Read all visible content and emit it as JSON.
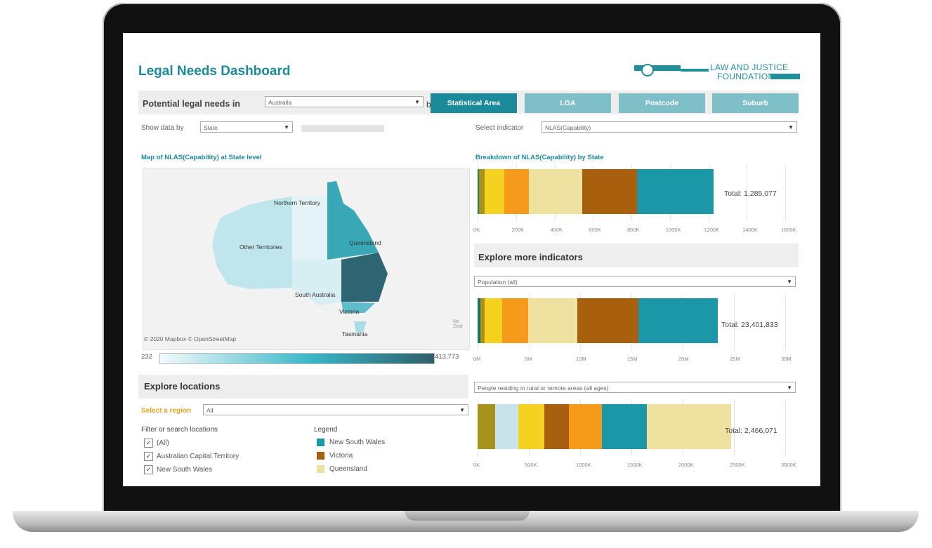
{
  "dashboard": {
    "title": "Legal Needs Dashboard",
    "logo_line1": "LAW AND JUSTICE",
    "logo_line2": "FOUNDATION"
  },
  "toolbar": {
    "label": "Potential legal needs in",
    "country_value": "Australia",
    "by_label": "by",
    "tabs": [
      {
        "label": "Statistical Area",
        "active": true
      },
      {
        "label": "LGA",
        "active": false
      },
      {
        "label": "Postcode",
        "active": false
      },
      {
        "label": "Suburb",
        "active": false
      }
    ]
  },
  "filters": {
    "show_data_by_label": "Show data by",
    "show_data_by_value": "State",
    "select_indicator_label": "Select indicator",
    "select_indicator_value": "NLAS(Capability)"
  },
  "map": {
    "section_label": "Map of NLAS(Capability) at State level",
    "labels": [
      "Northern Territory",
      "Other Territories",
      "Queensland",
      "South Australia",
      "Victoria",
      "Tasmania"
    ],
    "copyright": "© 2020 Mapbox © OpenStreetMap",
    "mapbox_note": "Ne Zeal",
    "scale_min": "232",
    "scale_max": "413,773"
  },
  "breakdown": {
    "section_label": "Breakdown of NLAS(Capability) by State",
    "total": "Total: 1,285,077"
  },
  "explore_indicators": {
    "heading": "Explore more indicators",
    "select1": "Population (all)",
    "total1": "Total: 23,401,833",
    "select2": "People residing in rural or remote areas (all ages)",
    "total2": "Total: 2,466,071"
  },
  "explore_locations": {
    "heading": "Explore locations",
    "region_label": "Select a region",
    "region_value": "All",
    "filter_title": "Filter or search locations",
    "checks": [
      "(All)",
      "Australian Capital Territory",
      "New South Wales"
    ],
    "legend_title": "Legend",
    "legend": [
      {
        "label": "New South Wales",
        "color": "#1b97a8"
      },
      {
        "label": "Victoria",
        "color": "#a8600f"
      },
      {
        "label": "Queensland",
        "color": "#efe2a0"
      }
    ]
  },
  "colors": {
    "accent": "#1b8a9b",
    "tab_inactive": "#7fbfc7",
    "region_label": "#e8a021"
  },
  "chart_data": [
    {
      "type": "bar",
      "orientation": "horizontal-stacked",
      "title": "Breakdown of NLAS(Capability) by State",
      "total_label": "Total: 1,285,077",
      "xlim": [
        0,
        1600000
      ],
      "tick_labels": [
        "0K",
        "200K",
        "400K",
        "600K",
        "800K",
        "1000K",
        "1200K",
        "1400K",
        "1600K"
      ],
      "segments": [
        {
          "value": 8000,
          "color": "#1a7a5a"
        },
        {
          "value": 30000,
          "color": "#a8921b"
        },
        {
          "value": 100000,
          "color": "#f5d21f"
        },
        {
          "value": 130000,
          "color": "#f59a1b"
        },
        {
          "value": 275000,
          "color": "#efe2a0"
        },
        {
          "value": 285000,
          "color": "#a8600f"
        },
        {
          "value": 400000,
          "color": "#1b97a8"
        }
      ]
    },
    {
      "type": "bar",
      "orientation": "horizontal-stacked",
      "title": "Population (all)",
      "total_label": "Total: 23,401,833",
      "xlim": [
        0,
        30000000
      ],
      "tick_labels": [
        "0M",
        "5M",
        "10M",
        "15M",
        "20M",
        "25M",
        "30M"
      ],
      "segments": [
        {
          "value": 300000,
          "color": "#1a7a5a"
        },
        {
          "value": 400000,
          "color": "#a8921b"
        },
        {
          "value": 1700000,
          "color": "#f5d21f"
        },
        {
          "value": 2500000,
          "color": "#f59a1b"
        },
        {
          "value": 4800000,
          "color": "#efe2a0"
        },
        {
          "value": 6000000,
          "color": "#a8600f"
        },
        {
          "value": 7700000,
          "color": "#1b97a8"
        }
      ]
    },
    {
      "type": "bar",
      "orientation": "horizontal-stacked",
      "title": "People residing in rural or remote areas (all ages)",
      "total_label": "Total: 2,466,071",
      "xlim": [
        0,
        3000000
      ],
      "tick_labels": [
        "0K",
        "500K",
        "1000K",
        "1500K",
        "2000K",
        "2500K",
        "3000K"
      ],
      "segments": [
        {
          "value": 170000,
          "color": "#a8921b"
        },
        {
          "value": 230000,
          "color": "#c8e4ea"
        },
        {
          "value": 250000,
          "color": "#f5d21f"
        },
        {
          "value": 240000,
          "color": "#a8600f"
        },
        {
          "value": 320000,
          "color": "#f59a1b"
        },
        {
          "value": 440000,
          "color": "#1b97a8"
        },
        {
          "value": 820000,
          "color": "#efe2a0"
        }
      ]
    }
  ]
}
